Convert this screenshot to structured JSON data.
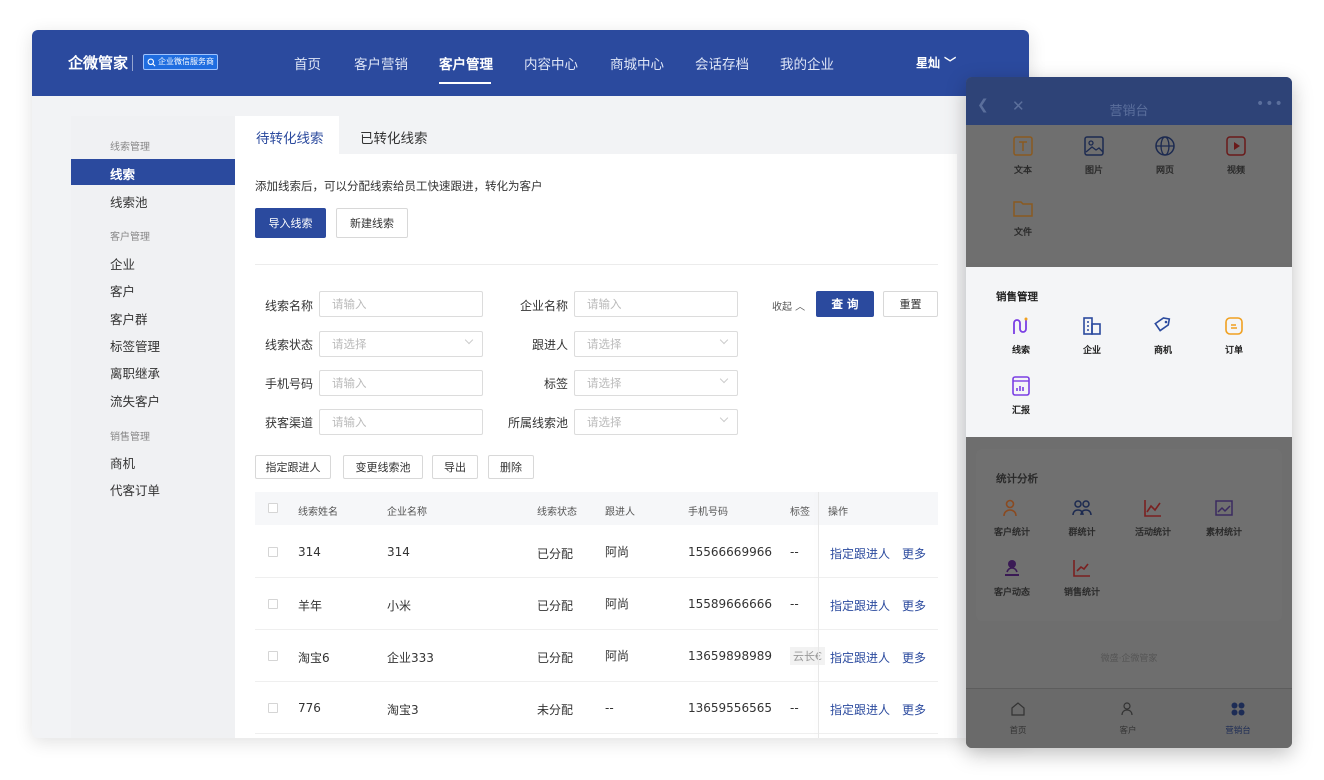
{
  "header": {
    "brand": "企微管家",
    "badge": "企业微信服务商",
    "nav": [
      "首页",
      "客户营销",
      "客户管理",
      "内容中心",
      "商城中心",
      "会话存档",
      "我的企业"
    ],
    "active_nav": "客户管理",
    "user": "星灿 ﹀"
  },
  "sidebar": {
    "groups": [
      {
        "title": "线索管理",
        "items": [
          "线索",
          "线索池"
        ]
      },
      {
        "title": "客户管理",
        "items": [
          "企业",
          "客户",
          "客户群",
          "标签管理",
          "离职继承",
          "流失客户"
        ]
      },
      {
        "title": "销售管理",
        "items": [
          "商机",
          "代客订单"
        ]
      }
    ],
    "active": "线索"
  },
  "tabs": {
    "active": "待转化线索",
    "other": "已转化线索"
  },
  "hint": "添加线索后，可以分配线索给员工快速跟进，转化为客户",
  "actions": {
    "import": "导入线索",
    "create": "新建线索"
  },
  "filters": {
    "lead_name": {
      "label": "线索名称",
      "placeholder": "请输入"
    },
    "company_name": {
      "label": "企业名称",
      "placeholder": "请输入"
    },
    "lead_status": {
      "label": "线索状态",
      "placeholder": "请选择"
    },
    "follower": {
      "label": "跟进人",
      "placeholder": "请选择"
    },
    "phone": {
      "label": "手机号码",
      "placeholder": "请输入"
    },
    "tag": {
      "label": "标签",
      "placeholder": "请选择"
    },
    "channel": {
      "label": "获客渠道",
      "placeholder": "请输入"
    },
    "pool": {
      "label": "所属线索池",
      "placeholder": "请选择"
    },
    "collapse": "收起 ︿",
    "search": "查 询",
    "reset": "重置"
  },
  "bulk": {
    "assign": "指定跟进人",
    "change_pool": "变更线索池",
    "export": "导出",
    "delete": "删除"
  },
  "table": {
    "columns": [
      "线索姓名",
      "企业名称",
      "线索状态",
      "跟进人",
      "手机号码",
      "标签",
      "操作"
    ],
    "rows": [
      {
        "name": "314",
        "company": "314",
        "status": "已分配",
        "follower": "阿尚",
        "phone": "15566669966",
        "tag": "--"
      },
      {
        "name": "羊年",
        "company": "小米",
        "status": "已分配",
        "follower": "阿尚",
        "phone": "15589666666",
        "tag": "--"
      },
      {
        "name": "淘宝6",
        "company": "企业333",
        "status": "已分配",
        "follower": "阿尚",
        "phone": "13659898989",
        "tag": "云长€"
      },
      {
        "name": "776",
        "company": "淘宝3",
        "status": "未分配",
        "follower": "--",
        "phone": "13659556565",
        "tag": "--"
      }
    ],
    "op_assign": "指定跟进人",
    "op_more": "更多"
  },
  "mobile": {
    "title": "营销台",
    "content_items": [
      "文本",
      "图片",
      "网页",
      "视频",
      "文件"
    ],
    "sales_title": "销售管理",
    "sales_items": [
      "线索",
      "企业",
      "商机",
      "订单",
      "汇报"
    ],
    "stats_title": "统计分析",
    "stats_items": [
      "客户统计",
      "群统计",
      "活动统计",
      "素材统计",
      "客户动态",
      "销售统计"
    ],
    "footer": "微盛·企微管家",
    "tabbar": [
      "首页",
      "客户",
      "营销台"
    ],
    "colors": {
      "accent": "#2b4a9e",
      "sales_icon": "#7b3fe4",
      "order_icon": "#f0a020",
      "stats_icon": "#e04040"
    }
  }
}
